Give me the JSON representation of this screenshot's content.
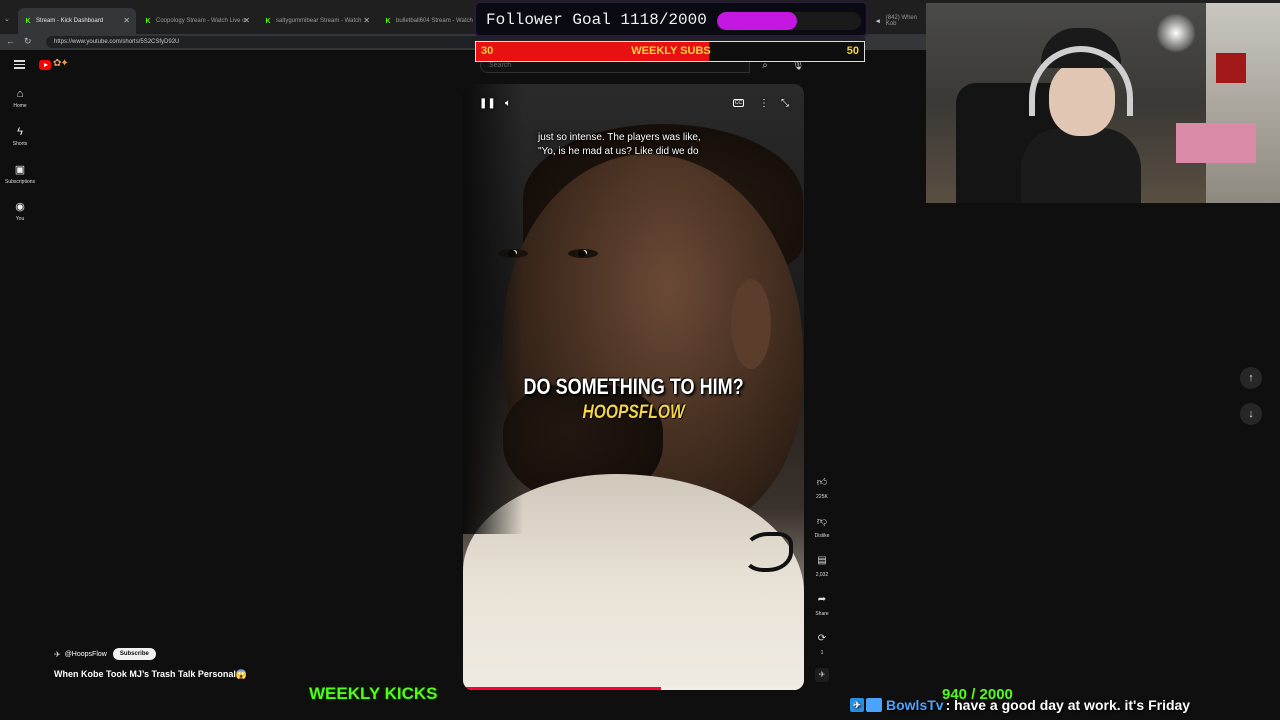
{
  "browser": {
    "tabs": [
      {
        "title": "Stream - Kick Dashboard",
        "active": true
      },
      {
        "title": "Coopology Stream - Watch Live o",
        "active": false
      },
      {
        "title": "saltygummibear Stream - Watch",
        "active": false
      },
      {
        "title": "bulletball604 Stream - Watch",
        "active": false
      },
      {
        "title": "(842) When Kob",
        "active": false
      }
    ],
    "url": "https://www.youtube.com/shorts/5S2CSfyD92U"
  },
  "youtube": {
    "search_placeholder": "Search",
    "sidebar": [
      {
        "label": "Home",
        "icon": "home-icon",
        "glyph": "⌂"
      },
      {
        "label": "Shorts",
        "icon": "shorts-icon",
        "glyph": "ϟ"
      },
      {
        "label": "Subscriptions",
        "icon": "subscriptions-icon",
        "glyph": "▣"
      },
      {
        "label": "You",
        "icon": "you-icon",
        "glyph": "◉"
      }
    ],
    "video": {
      "caption_line1": "just so intense. The players was like,",
      "caption_line2": "\"Yo, is he mad at us? Like did we do",
      "big_subtitle": "DO SOMETHING TO HIM?",
      "brand_subtitle": "HOOPSFLOW",
      "progress_fraction": 0.58
    },
    "actions": [
      {
        "name": "like-button",
        "icon": "thumbs-up-icon",
        "glyph": "👍︎",
        "label": "225K"
      },
      {
        "name": "dislike-button",
        "icon": "thumbs-down-icon",
        "glyph": "👎︎",
        "label": "Dislike"
      },
      {
        "name": "comments-button",
        "icon": "comment-icon",
        "glyph": "▤",
        "label": "2,032"
      },
      {
        "name": "share-button",
        "icon": "share-icon",
        "glyph": "➦",
        "label": "Share"
      },
      {
        "name": "remix-button",
        "icon": "remix-icon",
        "glyph": "⟳",
        "label": "1"
      }
    ],
    "channel": {
      "handle": "@HoopsFlow",
      "subscribe_label": "Subscribe",
      "video_title": "When Kobe Took MJ’s Trash Talk Personal😱"
    }
  },
  "overlays": {
    "follower_goal": {
      "label": "Follower Goal 1118/2000",
      "fraction": 0.559
    },
    "weekly_subs": {
      "label": "WEEKLY SUBS",
      "current": "30",
      "target": "50",
      "fraction": 0.6
    },
    "weekly_kicks": {
      "label": "WEEKLY KICKS",
      "progress": "940 / 2000"
    },
    "chat": {
      "user": "BowlsTv",
      "message": ": have a good day at work. it's Friday"
    }
  },
  "colors": {
    "kick_green": "#53fc18",
    "follower_bar": "#c417e0",
    "subs_bar": "#e81010",
    "subs_text": "#f2d43b",
    "youtube_red": "#ff0000"
  }
}
